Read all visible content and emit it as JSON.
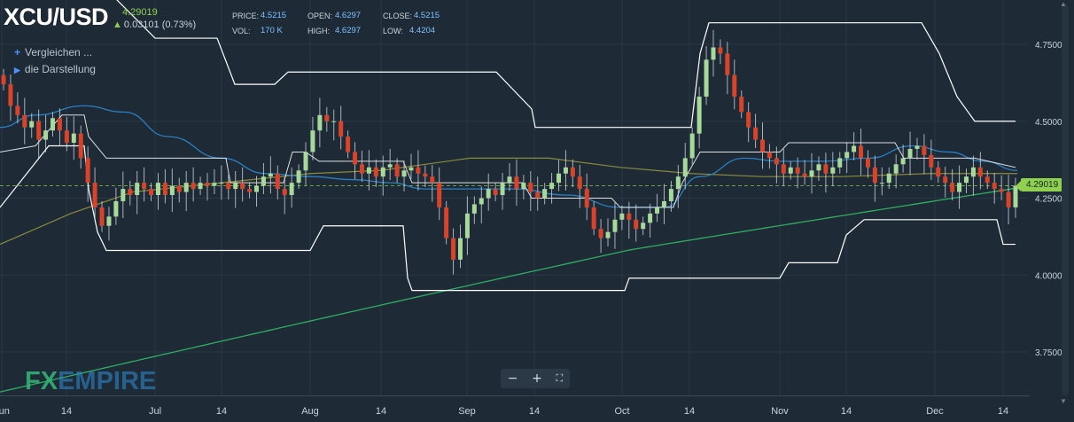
{
  "header": {
    "symbol": "XCU/USD",
    "last_price": "4.29019",
    "change": "0.03101 (0.73%)",
    "stats": [
      {
        "label": "PRICE:",
        "value": "4.5215"
      },
      {
        "label": "OPEN:",
        "value": "4.6297"
      },
      {
        "label": "CLOSE:",
        "value": "4.5215"
      },
      {
        "label": "VOL:",
        "value": "170 K"
      },
      {
        "label": "HIGH:",
        "value": "4.6297"
      },
      {
        "label": "LOW:",
        "value": "4.4204"
      }
    ]
  },
  "menu": {
    "compare": "Vergleichen ...",
    "display": "die Darstellung"
  },
  "controls": {
    "zoom_out": "−",
    "zoom_in": "+",
    "fullscreen": "⛶"
  },
  "logo": {
    "fx": "FX",
    "empire": "EMPIRE"
  },
  "price_tag": "4.29019",
  "colors": {
    "background": "#1e2a36",
    "up": "#a6d99a",
    "down": "#d9432a",
    "channel": "#ffffff",
    "ma_blue": "#2a7fc0",
    "ma_olive": "#8a8a3a",
    "ma_green": "#2fae61",
    "price_tag": "#8fd14f"
  },
  "chart_data": {
    "type": "line",
    "title": "",
    "xlabel": "",
    "ylabel": "",
    "ylim": [
      3.55,
      4.88
    ],
    "yticks": [
      "3.7500",
      "4.0000",
      "4.2500",
      "4.5000",
      "4.7500"
    ],
    "xticks": [
      "Jun",
      "14",
      "Jul",
      "14",
      "Aug",
      "14",
      "Sep",
      "14",
      "Oct",
      "14",
      "Nov",
      "14",
      "Dec",
      "14"
    ],
    "current_price": 4.29019,
    "candles": {
      "description": "OHLC daily candles, Jun through mid Dec",
      "closes": [
        4.62,
        4.55,
        4.52,
        4.48,
        4.5,
        4.44,
        4.47,
        4.51,
        4.47,
        4.43,
        4.46,
        4.38,
        4.3,
        4.22,
        4.16,
        4.19,
        4.24,
        4.28,
        4.26,
        4.3,
        4.28,
        4.26,
        4.3,
        4.26,
        4.29,
        4.27,
        4.3,
        4.28,
        4.3,
        4.29,
        4.3,
        4.3,
        4.28,
        4.3,
        4.28,
        4.27,
        4.29,
        4.32,
        4.33,
        4.28,
        4.26,
        4.3,
        4.34,
        4.4,
        4.47,
        4.52,
        4.5,
        4.5,
        4.45,
        4.4,
        4.36,
        4.33,
        4.35,
        4.32,
        4.35,
        4.36,
        4.32,
        4.34,
        4.35,
        4.33,
        4.32,
        4.3,
        4.22,
        4.12,
        4.05,
        4.12,
        4.2,
        4.23,
        4.25,
        4.28,
        4.26,
        4.3,
        4.32,
        4.28,
        4.3,
        4.27,
        4.25,
        4.28,
        4.3,
        4.33,
        4.35,
        4.32,
        4.28,
        4.22,
        4.15,
        4.12,
        4.14,
        4.18,
        4.2,
        4.18,
        4.15,
        4.17,
        4.2,
        4.22,
        4.24,
        4.28,
        4.32,
        4.38,
        4.46,
        4.58,
        4.7,
        4.74,
        4.72,
        4.65,
        4.58,
        4.53,
        4.48,
        4.44,
        4.4,
        4.38,
        4.36,
        4.33,
        4.35,
        4.33,
        4.32,
        4.34,
        4.36,
        4.33,
        4.35,
        4.38,
        4.4,
        4.42,
        4.38,
        4.35,
        4.3,
        4.3,
        4.33,
        4.36,
        4.38,
        4.41,
        4.42,
        4.39,
        4.35,
        4.32,
        4.3,
        4.27,
        4.3,
        4.32,
        4.35,
        4.32,
        4.3,
        4.28,
        4.27,
        4.22,
        4.29
      ]
    },
    "series": [
      {
        "name": "",
        "values": "upper channel band"
      },
      {
        "name": "",
        "values": "lower channel band"
      },
      {
        "name": "",
        "values": "blue moving average"
      },
      {
        "name": "",
        "values": "olive moving average"
      },
      {
        "name": "",
        "values": "green moving average"
      }
    ],
    "grid": true
  }
}
